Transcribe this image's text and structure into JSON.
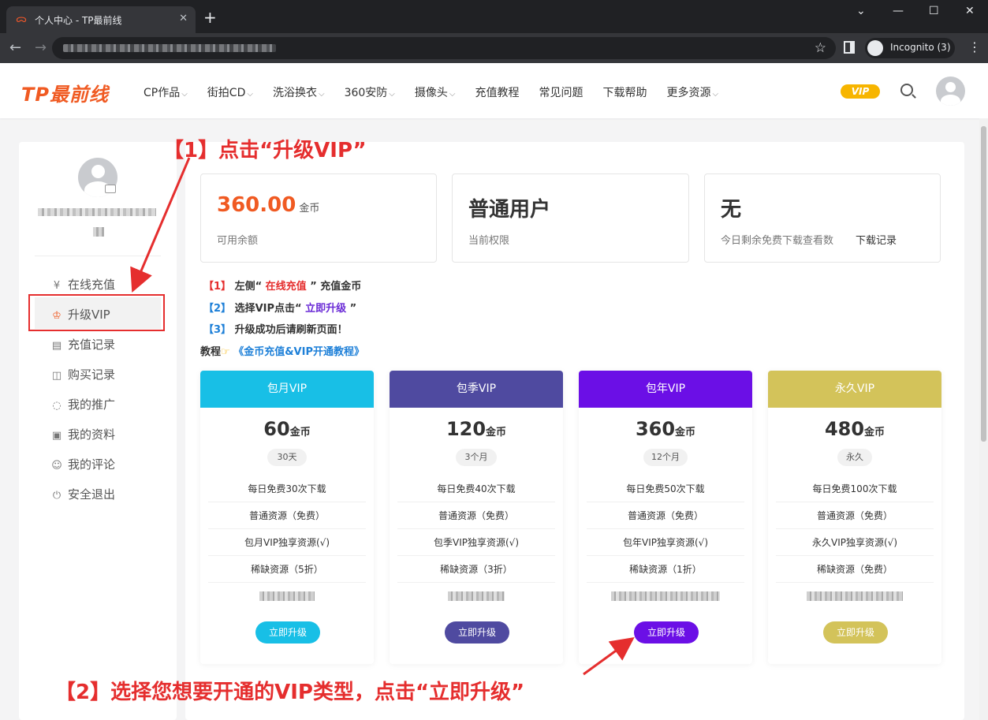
{
  "browser": {
    "tab_title": "个人中心 - TP最前线",
    "tab_close": "✕",
    "new_tab": "+",
    "incognito_label": "Incognito (3)",
    "controls": {
      "minimize": "—",
      "maximize": "☐",
      "close": "✕",
      "collapse": "⌄"
    }
  },
  "header": {
    "logo": "TP最前线",
    "nav": [
      {
        "label": "CP作品",
        "dropdown": true
      },
      {
        "label": "街拍CD",
        "dropdown": true
      },
      {
        "label": "洗浴换衣",
        "dropdown": true
      },
      {
        "label": "360安防",
        "dropdown": true
      },
      {
        "label": "摄像头",
        "dropdown": true
      },
      {
        "label": "充值教程",
        "dropdown": false
      },
      {
        "label": "常见问题",
        "dropdown": false
      },
      {
        "label": "下载帮助",
        "dropdown": false
      },
      {
        "label": "更多资源",
        "dropdown": true
      }
    ],
    "vip_badge": "VIP"
  },
  "sidebar": {
    "items": [
      {
        "label": "在线充值",
        "icon": "yen-icon",
        "glyph": "¥"
      },
      {
        "label": "升级VIP",
        "icon": "crown-icon",
        "glyph": "♔"
      },
      {
        "label": "充值记录",
        "icon": "wallet-icon",
        "glyph": "▤"
      },
      {
        "label": "购买记录",
        "icon": "bag-icon",
        "glyph": "◫"
      },
      {
        "label": "我的推广",
        "icon": "share-icon",
        "glyph": "◌"
      },
      {
        "label": "我的资料",
        "icon": "profile-card-icon",
        "glyph": "▣"
      },
      {
        "label": "我的评论",
        "icon": "comment-icon",
        "glyph": "☺"
      },
      {
        "label": "安全退出",
        "icon": "power-icon",
        "glyph": "⏻"
      }
    ],
    "active_index": 1
  },
  "stats": {
    "balance": {
      "value": "360.00",
      "unit": "金币",
      "label": "可用余额"
    },
    "level": {
      "value": "普通用户",
      "label": "当前权限"
    },
    "free_downloads": {
      "value": "无",
      "label": "今日剩余免费下载查看数",
      "link": "下载记录"
    }
  },
  "tips": {
    "step1": {
      "num": "【1】",
      "pre": " 左侧“ ",
      "hl": "在线充值",
      "post": " ” 充值金币"
    },
    "step2": {
      "num": "【2】",
      "pre": " 选择VIP点击“ ",
      "hl": "立即升级",
      "post": " ”"
    },
    "step3": {
      "num": "【3】",
      "text": " 升级成功后请刷新页面！"
    },
    "tutorial": {
      "label": "教程",
      "icon": "pointing-hand-icon",
      "link": "《金币充值&VIP开通教程》"
    }
  },
  "plans": [
    {
      "name": "包月VIP",
      "price": "60",
      "unit": "金币",
      "duration": "30天",
      "color": "#18bfe6",
      "features": [
        "每日免费30次下载",
        "普通资源（免费）",
        "包月VIP独享资源(√)",
        "稀缺资源（5折）"
      ],
      "button": "立即升级"
    },
    {
      "name": "包季VIP",
      "price": "120",
      "unit": "金币",
      "duration": "3个月",
      "color": "#4f4aa0",
      "features": [
        "每日免费40次下载",
        "普通资源（免费）",
        "包季VIP独享资源(√)",
        "稀缺资源（3折）"
      ],
      "button": "立即升级"
    },
    {
      "name": "包年VIP",
      "price": "360",
      "unit": "金币",
      "duration": "12个月",
      "color": "#6b0fe6",
      "features": [
        "每日免费50次下载",
        "普通资源（免费）",
        "包年VIP独享资源(√)",
        "稀缺资源（1折）"
      ],
      "button": "立即升级"
    },
    {
      "name": "永久VIP",
      "price": "480",
      "unit": "金币",
      "duration": "永久",
      "color": "#d3c35a",
      "features": [
        "每日免费100次下载",
        "普通资源（免费）",
        "永久VIP独享资源(√)",
        "稀缺资源（免费）"
      ],
      "button": "立即升级"
    }
  ],
  "annotations": {
    "step1": "【1】点击“升级VIP”",
    "step2": "【2】选择您想要开通的VIP类型，点击“立即升级”"
  },
  "colors": {
    "brand": "#f05a22",
    "vip_gold": "#f7b500",
    "annotation_red": "#e52e2e",
    "link_blue": "#1e80d8"
  }
}
